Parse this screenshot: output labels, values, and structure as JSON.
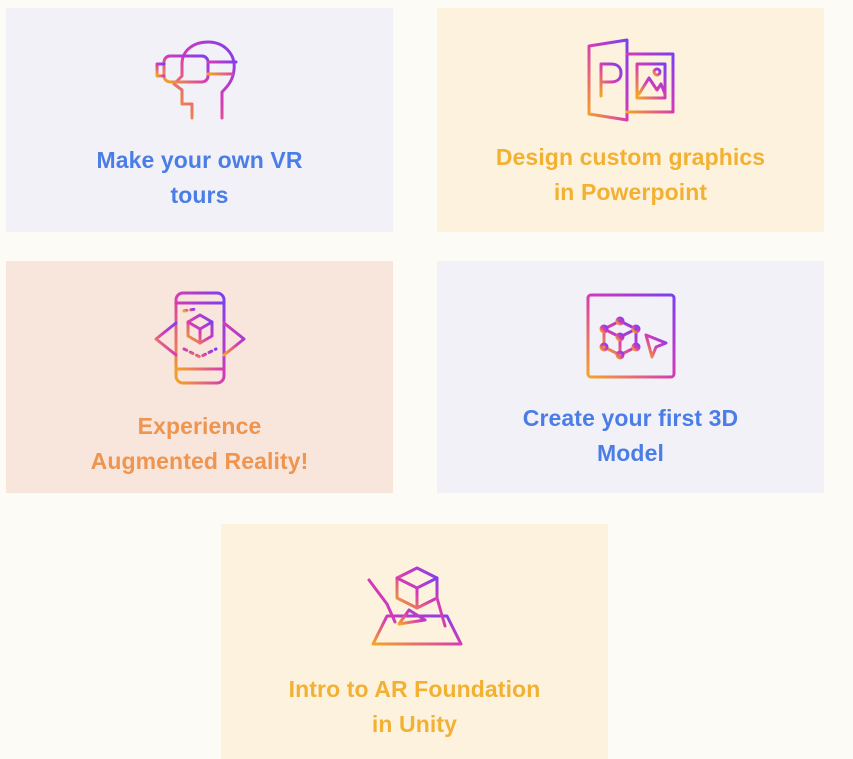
{
  "cards": [
    {
      "id": "vr",
      "icon": "vr-headset-icon",
      "line1": "Make your own VR",
      "line2": "tours",
      "color": "#4a7ee6",
      "background": "#f2f1f8"
    },
    {
      "id": "ppt",
      "icon": "powerpoint-icon",
      "line1": "Design custom graphics",
      "line2": "in Powerpoint",
      "color": "#f3b133",
      "background": "#fdf2dd"
    },
    {
      "id": "ar",
      "icon": "augmented-reality-phone-icon",
      "line1": "Experience",
      "line2": "Augmented Reality!",
      "color": "#ee9550",
      "background": "#f8e5dc"
    },
    {
      "id": "3d",
      "icon": "3d-model-window-icon",
      "line1": "Create your first 3D",
      "line2": "Model",
      "color": "#4a7ee6",
      "background": "#f2f1f8"
    },
    {
      "id": "unity",
      "icon": "unity-ar-foundation-icon",
      "line1": "Intro to AR Foundation",
      "line2": "in Unity",
      "color": "#f3b133",
      "background": "#fdf2dd"
    }
  ],
  "icon_gradient": {
    "start": "#f5a623",
    "middle": "#d63ab5",
    "end": "#7b3ff2"
  }
}
